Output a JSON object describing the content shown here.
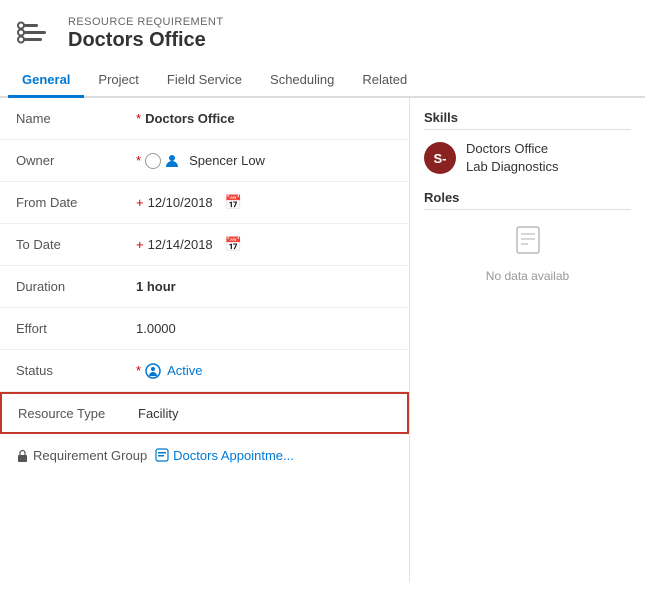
{
  "header": {
    "record_type": "RESOURCE REQUIREMENT",
    "record_name": "Doctors Office"
  },
  "tabs": [
    {
      "label": "General",
      "active": true
    },
    {
      "label": "Project",
      "active": false
    },
    {
      "label": "Field Service",
      "active": false
    },
    {
      "label": "Scheduling",
      "active": false
    },
    {
      "label": "Related",
      "active": false
    }
  ],
  "fields": {
    "name_label": "Name",
    "name_value": "Doctors Office",
    "owner_label": "Owner",
    "owner_value": "Spencer Low",
    "from_date_label": "From Date",
    "from_date_value": "12/10/2018",
    "to_date_label": "To Date",
    "to_date_value": "12/14/2018",
    "duration_label": "Duration",
    "duration_value": "1 hour",
    "effort_label": "Effort",
    "effort_value": "1.0000",
    "status_label": "Status",
    "status_value": "Active",
    "resource_type_label": "Resource Type",
    "resource_type_value": "Facility",
    "req_group_label": "Requirement Group",
    "req_group_value": "Doctors Appointme..."
  },
  "right_panel": {
    "skills_title": "Skills",
    "skill_avatar_text": "S-",
    "skill_name_line1": "Doctors Office",
    "skill_name_line2": "Lab Diagnostics",
    "roles_title": "Roles",
    "no_data_label": "No data availab"
  }
}
